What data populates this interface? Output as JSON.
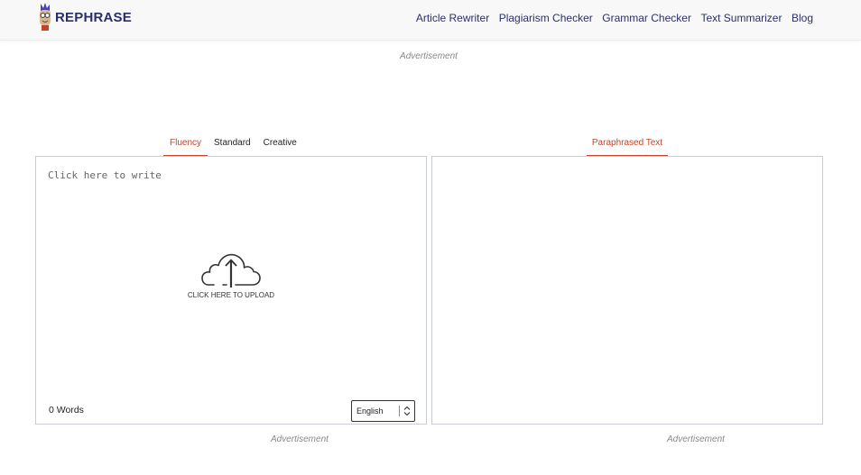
{
  "header": {
    "brand": "REPHRASE",
    "nav": [
      {
        "label": "Article Rewriter"
      },
      {
        "label": "Plagiarism Checker"
      },
      {
        "label": "Grammar Checker"
      },
      {
        "label": "Text Summarizer"
      },
      {
        "label": "Blog"
      }
    ]
  },
  "ads": {
    "top": "Advertisement",
    "left": "Advertisement",
    "right": "Advertisement"
  },
  "input_panel": {
    "tabs": [
      {
        "label": "Fluency",
        "active": true
      },
      {
        "label": "Standard",
        "active": false
      },
      {
        "label": "Creative",
        "active": false
      }
    ],
    "placeholder": "Click here to write",
    "value": "",
    "upload_label": "CLICK HERE TO UPLOAD",
    "word_count": "0 Words",
    "language": "English"
  },
  "output_panel": {
    "tab": "Paraphrased Text",
    "value": ""
  },
  "colors": {
    "brand": "#2a2f6b",
    "accent": "#c0452a",
    "panel_border": "#c9ccd6",
    "header_bg": "#f8f8f8"
  },
  "icons": {
    "logo": "mascot-logo-icon",
    "upload": "cloud-upload-icon",
    "select": "chevron-updown-icon"
  }
}
